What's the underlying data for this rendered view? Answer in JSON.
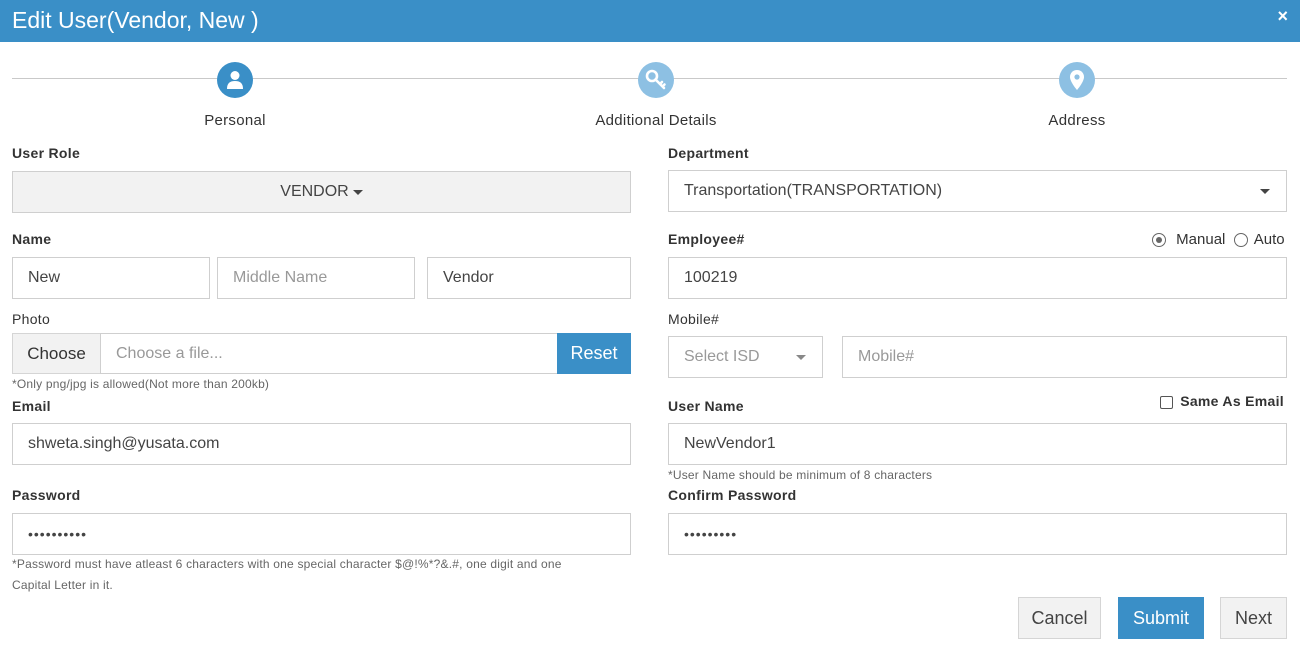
{
  "dialog": {
    "title": "Edit User(Vendor, New )",
    "close_icon": "×"
  },
  "steps": [
    {
      "label": "Personal",
      "icon": "user-icon",
      "state": "active"
    },
    {
      "label": "Additional Details",
      "icon": "key-icon",
      "state": "inactive"
    },
    {
      "label": "Address",
      "icon": "map-marker-icon",
      "state": "inactive"
    }
  ],
  "form": {
    "user_role": {
      "label": "User Role",
      "value": "VENDOR"
    },
    "department": {
      "label": "Department",
      "value": "Transportation(TRANSPORTATION)"
    },
    "name": {
      "label": "Name",
      "first": "New",
      "middle_placeholder": "Middle Name",
      "last": "Vendor"
    },
    "employee": {
      "label": "Employee#",
      "value": "100219",
      "mode_manual": "Manual",
      "mode_auto": "Auto",
      "selected_mode": "Manual"
    },
    "photo": {
      "label": "Photo",
      "choose_label": "Choose",
      "file_placeholder": "Choose a file...",
      "reset_label": "Reset",
      "hint": "*Only png/jpg is allowed(Not more than 200kb)"
    },
    "mobile": {
      "label": "Mobile#",
      "isd_placeholder": "Select ISD",
      "number_placeholder": "Mobile#"
    },
    "email": {
      "label": "Email",
      "value": "shweta.singh@yusata.com"
    },
    "username": {
      "label": "User Name",
      "value": "NewVendor1",
      "same_as_email_label": "Same As Email",
      "same_as_email_checked": false,
      "hint": "*User Name should be minimum of 8 characters"
    },
    "password": {
      "label": "Password",
      "value": "••••••••••",
      "hint_line1": "*Password must have atleast 6 characters with one special character $@!%*?&.#, one digit and one",
      "hint_line2": "Capital Letter in it."
    },
    "confirm_password": {
      "label": "Confirm Password",
      "value": "•••••••••"
    }
  },
  "actions": {
    "cancel": "Cancel",
    "submit": "Submit",
    "next": "Next"
  },
  "colors": {
    "primary": "#3a8fc7",
    "primary_light": "#8dc0e3"
  }
}
